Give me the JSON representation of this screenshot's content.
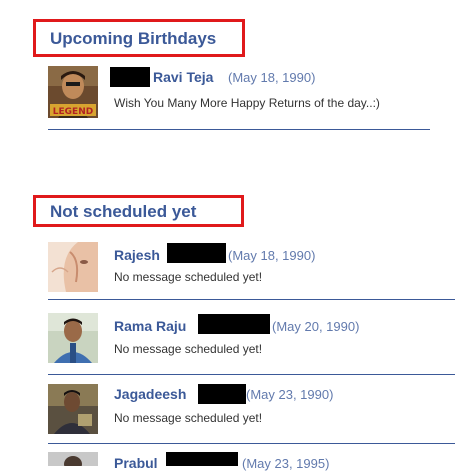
{
  "upcoming": {
    "title": "Upcoming Birthdays",
    "entries": [
      {
        "name": "Ravi Teja",
        "date": "(May 18, 1990)",
        "message": "Wish You Many More Happy Returns of the day..:)"
      }
    ]
  },
  "not_scheduled": {
    "title": "Not scheduled yet",
    "entries": [
      {
        "name": "Rajesh",
        "date": "(May 18, 1990)",
        "message": "No message scheduled yet!"
      },
      {
        "name": "Rama Raju",
        "date": "(May 20, 1990)",
        "message": "No message scheduled yet!"
      },
      {
        "name": "Jagadeesh",
        "date": "(May 23, 1990)",
        "message": "No message scheduled yet!"
      },
      {
        "name": "Prabul",
        "date": "(May 23, 1995)"
      }
    ]
  },
  "colors": {
    "heading": "#3b5998",
    "highlight_border": "#e0191b",
    "date": "#627aad",
    "redaction": "#000000"
  }
}
